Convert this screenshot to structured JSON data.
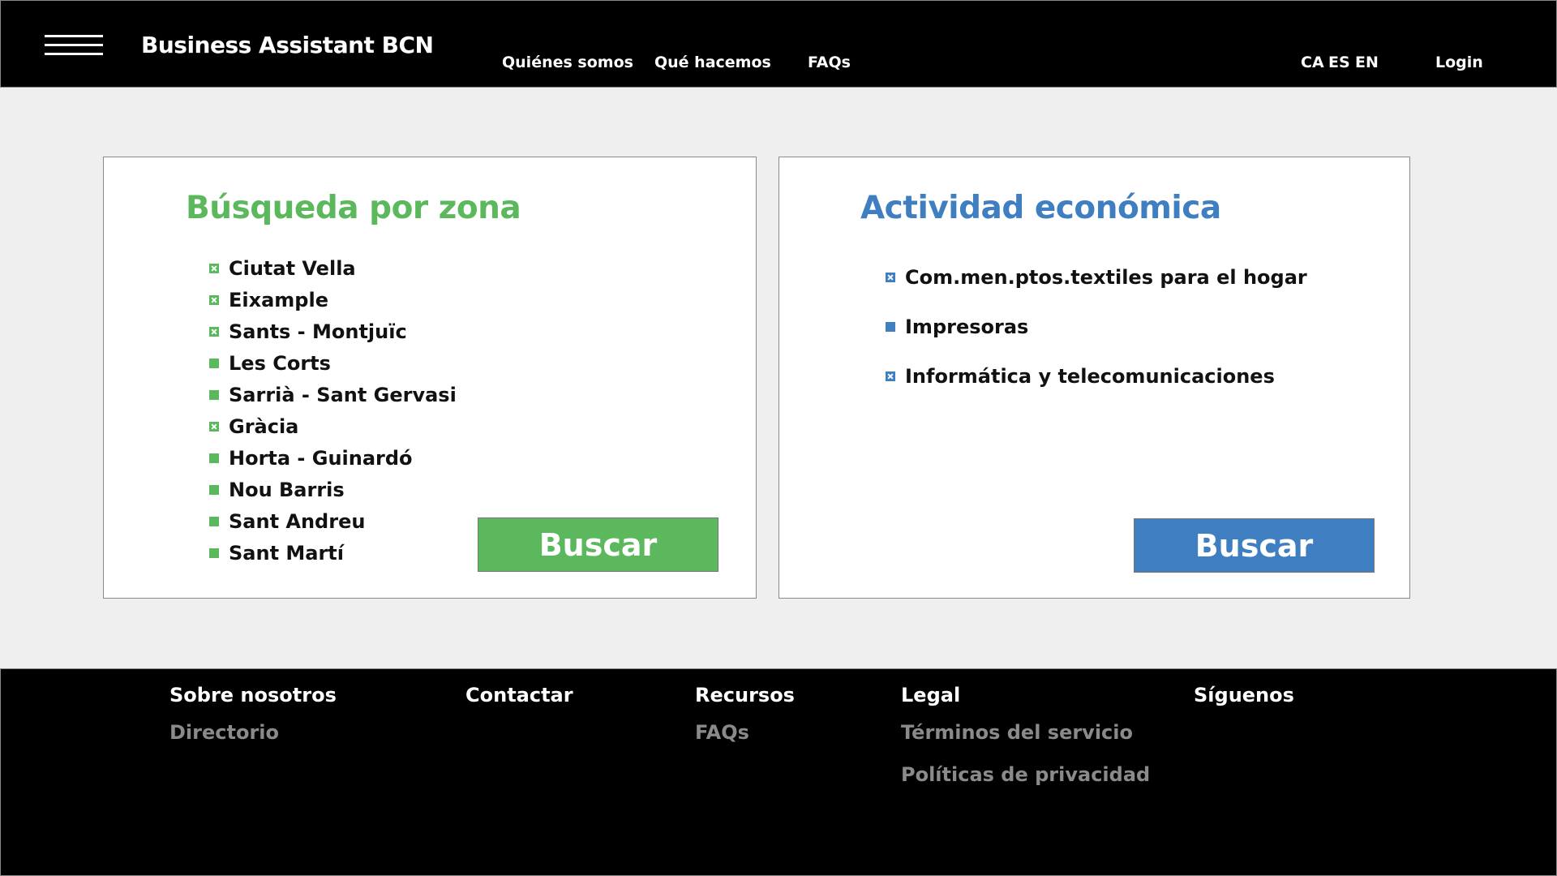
{
  "header": {
    "brand": "Business Assistant BCN",
    "nav": [
      "Quiénes somos",
      "Qué hacemos",
      "FAQs"
    ],
    "languages": [
      "CA",
      "ES",
      "EN"
    ],
    "login": "Login"
  },
  "zona": {
    "title": "Búsqueda por zona",
    "items": [
      {
        "label": "Ciutat Vella",
        "checked": true
      },
      {
        "label": "Eixample",
        "checked": true
      },
      {
        "label": "Sants - Montjuïc",
        "checked": true
      },
      {
        "label": "Les Corts",
        "checked": false
      },
      {
        "label": "Sarrià - Sant Gervasi",
        "checked": false
      },
      {
        "label": "Gràcia",
        "checked": true
      },
      {
        "label": "Horta - Guinardó",
        "checked": false
      },
      {
        "label": "Nou Barris",
        "checked": false
      },
      {
        "label": "Sant Andreu",
        "checked": false
      },
      {
        "label": "Sant Martí",
        "checked": false
      }
    ],
    "button": "Buscar",
    "accent": "#5cb85c"
  },
  "actividad": {
    "title": "Actividad económica",
    "items": [
      {
        "label": "Com.men.ptos.textiles para el hogar",
        "checked": true
      },
      {
        "label": "Impresoras",
        "checked": false
      },
      {
        "label": "Informática y telecomunicaciones",
        "checked": true
      }
    ],
    "button": "Buscar",
    "accent": "#3f7fc1"
  },
  "footer": {
    "columns": [
      {
        "heading": "Sobre nosotros",
        "links": [
          "Directorio"
        ]
      },
      {
        "heading": "Contactar",
        "links": []
      },
      {
        "heading": "Recursos",
        "links": [
          "FAQs"
        ]
      },
      {
        "heading": "Legal",
        "links": [
          "Términos del servicio",
          "Políticas de privacidad"
        ]
      },
      {
        "heading": "Síguenos",
        "links": []
      }
    ]
  }
}
